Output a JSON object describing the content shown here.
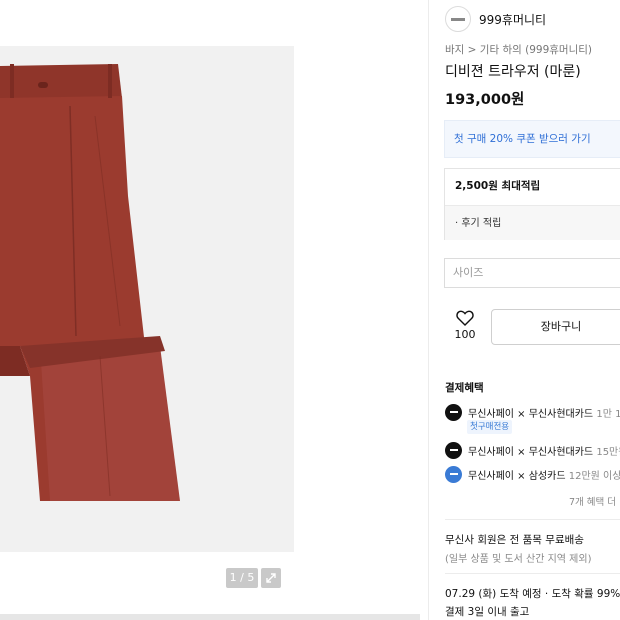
{
  "brand": {
    "name": "999휴머니티"
  },
  "breadcrumb": {
    "text": "바지 > 기타 하의 (999휴머니티)"
  },
  "product": {
    "title": "디비젼 트라우저 (마룬)",
    "price": "193,000원",
    "image_counter": "1 / 5",
    "pants_color": "#9b3b2f"
  },
  "coupon": {
    "text": "첫 구매 20% 쿠폰 받으러 가기"
  },
  "points": {
    "max": "2,500원 최대적립",
    "review": "· 후기 적립"
  },
  "size_select": {
    "placeholder": "사이즈"
  },
  "actions": {
    "like_count": "100",
    "cart_label": "장바구니"
  },
  "payment": {
    "title": "결제혜택",
    "benefits": [
      {
        "text": "무신사페이 × 무신사현대카드",
        "extra": "1만 1",
        "icon": "card-black"
      },
      {
        "text": "무신사페이 × 무신사현대카드",
        "extra": "15만원",
        "icon": "card-black"
      },
      {
        "text": "무신사페이 × 삼성카드",
        "extra": "12만원 이상",
        "icon": "card-blue"
      }
    ],
    "first_tag": "첫구매전용",
    "more": "7개 혜택 더"
  },
  "shipping": {
    "line1": "무신사 회원은 전 품목 무료배송",
    "line2": "(일부 상품 및 도서 산간 지역 제외)",
    "eta": "07.29 (화) 도착 예정 · 도착 확률 99%",
    "dispatch": "결제 3일 이내 출고"
  }
}
